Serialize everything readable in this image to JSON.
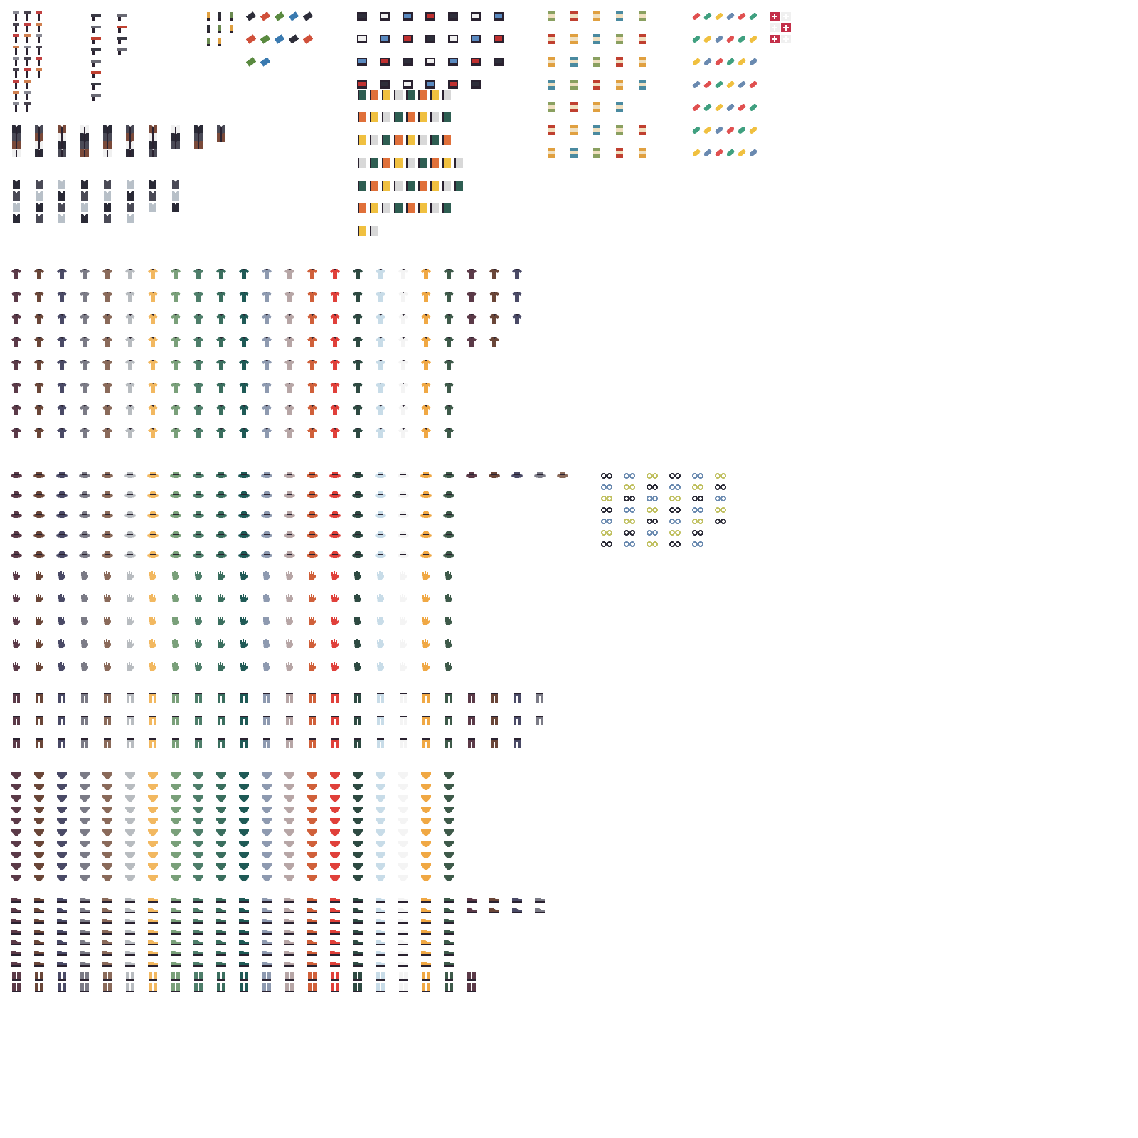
{
  "sheet": {
    "title": "",
    "palette": [
      "#5b3a48",
      "#6a4638",
      "#4a4a66",
      "#7b7b86",
      "#8a6a5a",
      "#b8bcc0",
      "#f2b860",
      "#7aa07a",
      "#4e7e6a",
      "#3a6e5e",
      "#1f5a56",
      "#8e9ab0",
      "#b7a6a6",
      "#d0603a",
      "#e0403a",
      "#2e4a42",
      "#c8dce8",
      "#f4f4f4",
      "#f0a844",
      "#3e5a4a"
    ],
    "accents": {
      "outline": "#2a2230",
      "white_shirt": "#f0f0f0",
      "medkit_red": "#c4304a",
      "pill_red": "#e05050",
      "gold": "#f0c040"
    },
    "sections": [
      {
        "name": "weapons-tools",
        "icon": "tool-icon",
        "colors": [
          "#8a8a94",
          "#4a4450",
          "#c04040",
          "#d08050"
        ],
        "rows": [
          3,
          3,
          3,
          3,
          3,
          3,
          2,
          2,
          2
        ]
      },
      {
        "name": "guns",
        "icon": "gun-icon",
        "colors": [
          "#3a3a44",
          "#6a6a74",
          "#c04030"
        ],
        "rows": [
          2,
          2,
          2,
          2,
          1,
          1,
          1,
          1
        ]
      },
      {
        "name": "ammo",
        "icon": "ammo-icon",
        "colors": [
          "#e0a040",
          "#2e2e36",
          "#6a8a50"
        ],
        "rows": [
          3,
          3,
          2
        ]
      },
      {
        "name": "batteries-grenades",
        "icon": "battery-icon",
        "colors": [
          "#2e2e3a",
          "#d0503a",
          "#5a8a40",
          "#3a7ab0"
        ],
        "rows": [
          5,
          5,
          2
        ]
      },
      {
        "name": "electronics",
        "icon": "device-icon",
        "colors": [
          "#2e2e3a",
          "#f0f0f0",
          "#5a8ac0",
          "#c03030"
        ],
        "rows": [
          7,
          7,
          7,
          6
        ]
      },
      {
        "name": "books-documents",
        "icon": "book-icon",
        "colors": [
          "#2e5e52",
          "#e0703a",
          "#f0c040",
          "#d8d8d8"
        ],
        "rows": [
          8,
          8,
          8,
          9,
          9,
          8,
          2
        ]
      },
      {
        "name": "canned-food",
        "icon": "can-icon",
        "colors": [
          "#8aa060",
          "#c04030",
          "#e0a040",
          "#4a8aa0"
        ],
        "rows": [
          5,
          5,
          5,
          5,
          4,
          5,
          5
        ]
      },
      {
        "name": "medicine",
        "icon": "pill-icon",
        "colors": [
          "#e05050",
          "#40a080",
          "#f0c040",
          "#6a8ab0"
        ],
        "rows": [
          6,
          6,
          6,
          6,
          6,
          6,
          6
        ]
      },
      {
        "name": "first-aid",
        "icon": "medkit-icon",
        "colors": [
          "#c4304a",
          "#f0f0f0"
        ],
        "rows": [
          2,
          2,
          2
        ]
      },
      {
        "name": "jackets",
        "icon": "jacket-icon",
        "colors": [
          "#2a2a36",
          "#4a4a56",
          "#7a4a3a",
          "#f0f0f0"
        ],
        "rows": [
          10,
          10,
          9,
          7
        ]
      },
      {
        "name": "vests",
        "icon": "vest-icon",
        "colors": [
          "#2a2a36",
          "#4a4a56",
          "#b8c0c8"
        ],
        "rows": [
          8,
          8,
          8,
          6
        ]
      },
      {
        "name": "shirts",
        "icon": "shirt-icon",
        "colors": [
          "#5b3a48",
          "#f2b860",
          "#3a6e5e",
          "#d0603a"
        ],
        "rows": [
          23,
          23,
          23,
          22,
          20,
          20,
          20,
          20
        ]
      },
      {
        "name": "hats",
        "icon": "hat-icon",
        "colors": [
          "#5b3a48",
          "#f2b860",
          "#3a6e5e",
          "#d0603a"
        ],
        "rows": [
          25,
          20,
          20,
          20,
          20
        ]
      },
      {
        "name": "eyewear",
        "icon": "glasses-icon",
        "colors": [
          "#2a2a36",
          "#6a8ab0",
          "#c0c060"
        ],
        "rows": [
          6,
          6,
          6,
          6,
          6,
          5,
          5
        ]
      },
      {
        "name": "gloves",
        "icon": "glove-icon",
        "colors": [
          "#5b3a48",
          "#f2b860",
          "#3a6e5e",
          "#d0603a"
        ],
        "rows": [
          20,
          20,
          20,
          20,
          20
        ]
      },
      {
        "name": "pants",
        "icon": "pants-icon",
        "colors": [
          "#2e2e3a",
          "#8a8a94",
          "#c04040",
          "#d0a040"
        ],
        "rows": [
          24,
          24,
          23
        ]
      },
      {
        "name": "underwear",
        "icon": "underwear-icon",
        "colors": [
          "#5b3a48",
          "#f2b860",
          "#3a6e5e",
          "#d0603a"
        ],
        "rows": [
          20,
          20,
          20,
          20,
          20,
          20,
          20,
          20,
          20,
          20
        ]
      },
      {
        "name": "shoes",
        "icon": "shoe-icon",
        "colors": [
          "#5b3a48",
          "#f2b860",
          "#3a6e5e",
          "#d0603a"
        ],
        "rows": [
          24,
          24,
          20,
          20,
          20,
          20,
          20
        ]
      },
      {
        "name": "socks",
        "icon": "sock-icon",
        "colors": [
          "#2e2e3a",
          "#e0e0e0",
          "#c04040"
        ],
        "rows": [
          21,
          21
        ]
      }
    ]
  }
}
